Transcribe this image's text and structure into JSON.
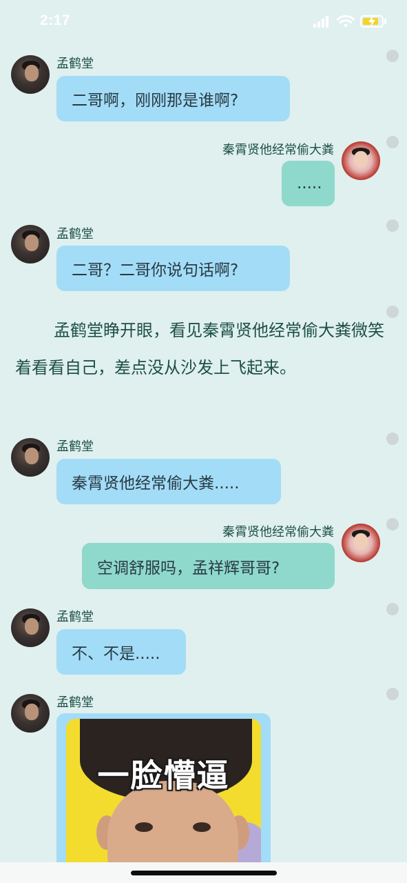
{
  "status_bar": {
    "time": "2:17"
  },
  "messages": [
    {
      "side": "left",
      "name": "孟鹤堂",
      "text": "二哥啊，刚刚那是谁啊?"
    },
    {
      "side": "right",
      "name": "秦霄贤他经常偷大粪",
      "text": "....."
    },
    {
      "side": "left",
      "name": "孟鹤堂",
      "text": "二哥？二哥你说句话啊?"
    },
    {
      "side": "left",
      "name": "孟鹤堂",
      "text": "秦霄贤他经常偷大粪....."
    },
    {
      "side": "right",
      "name": "秦霄贤他经常偷大粪",
      "text": "空调舒服吗，孟祥辉哥哥?"
    },
    {
      "side": "left",
      "name": "孟鹤堂",
      "text": "不、不是....."
    },
    {
      "side": "left",
      "name": "孟鹤堂",
      "sticker_text": "一脸懵逼"
    }
  ],
  "narration": "孟鹤堂睁开眼，看见秦霄贤他经常偷大粪微笑着看看自己，差点没从沙发上飞起来。",
  "colors": {
    "background": "#dff0ef",
    "left_bubble": "#a3dcf7",
    "right_bubble": "#8fd8cc",
    "name_text": "#1f4f47"
  }
}
